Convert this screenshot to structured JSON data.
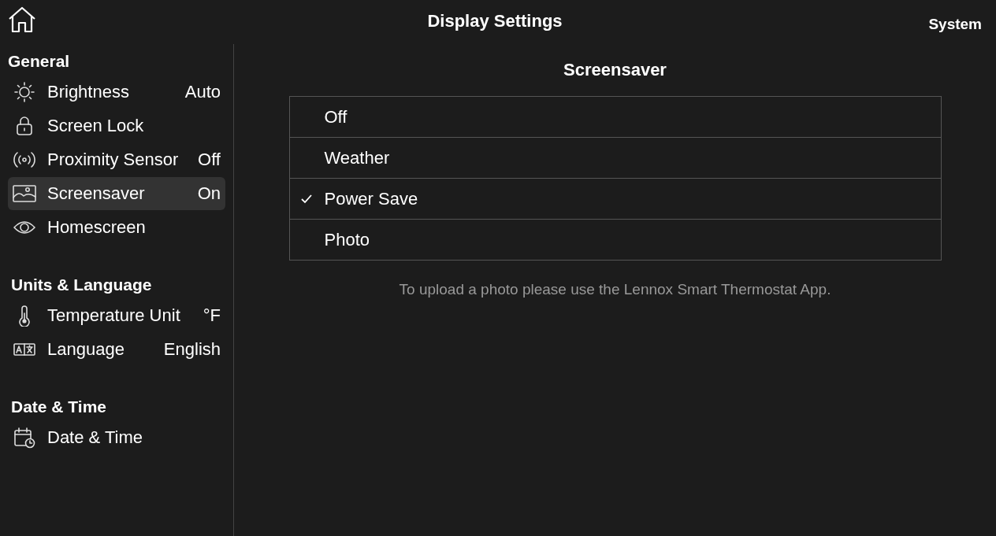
{
  "header": {
    "title": "Display Settings",
    "right_label": "System"
  },
  "sidebar": {
    "sections": [
      {
        "heading": "General",
        "items": [
          {
            "kind": "sun",
            "label": "Brightness",
            "value": "Auto",
            "selected": false
          },
          {
            "kind": "lock",
            "label": "Screen Lock",
            "selected": false
          },
          {
            "kind": "signal",
            "label": "Proximity Sensor",
            "value": "Off",
            "selected": false
          },
          {
            "kind": "image",
            "label": "Screensaver",
            "value": "On",
            "selected": true
          },
          {
            "kind": "eye",
            "label": "Homescreen",
            "selected": false
          }
        ]
      },
      {
        "heading": "Units & Language",
        "items": [
          {
            "kind": "thermometer",
            "label": "Temperature Unit",
            "value": "°F",
            "selected": false
          },
          {
            "kind": "translate",
            "label": "Language",
            "value": "English",
            "selected": false
          }
        ]
      },
      {
        "heading": "Date & Time",
        "items": [
          {
            "kind": "calendar",
            "label": "Date & Time",
            "selected": false
          }
        ]
      }
    ]
  },
  "panel": {
    "title": "Screensaver",
    "options": [
      {
        "label": "Off",
        "selected": false
      },
      {
        "label": "Weather",
        "selected": false
      },
      {
        "label": "Power Save",
        "selected": true
      },
      {
        "label": "Photo",
        "selected": false
      }
    ],
    "note": "To upload a photo please use the Lennox Smart Thermostat App."
  }
}
